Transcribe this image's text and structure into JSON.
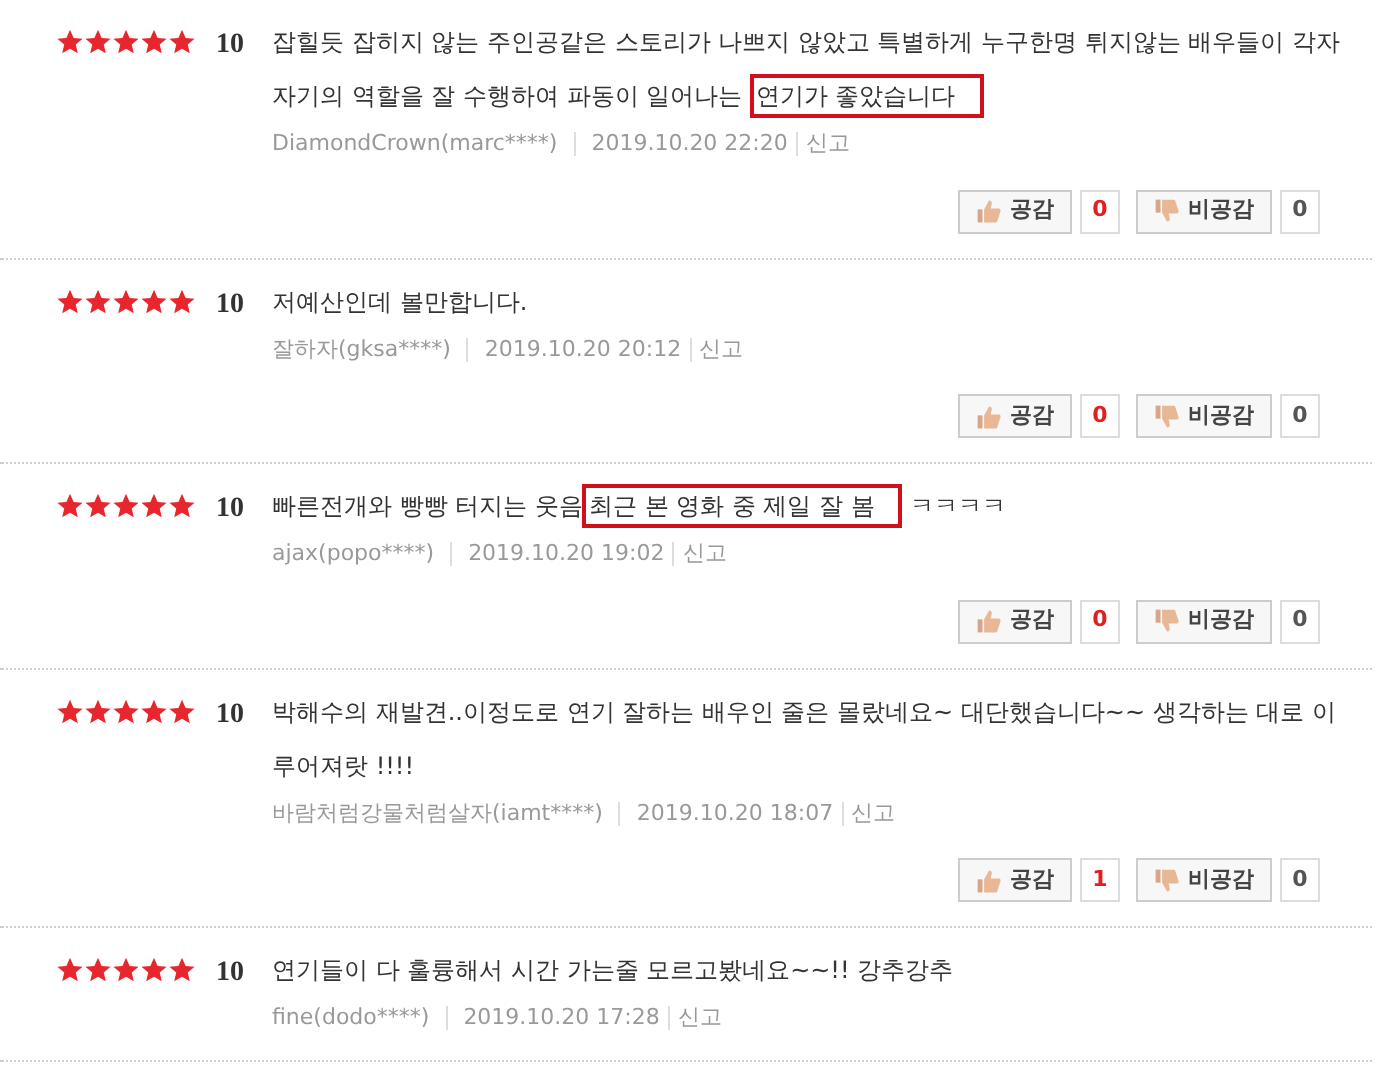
{
  "reviews": [
    {
      "stars": 5,
      "score": "10",
      "segments": [
        {
          "text": "잡힐듯 잡히지 않는 주인공같은 스토리가 나쁘지 않았고 특별하게 누구한명 튀지않는 배우들이 각자 자기의 역할을 잘 수행하여 파동이 일어나는 ",
          "highlighted": false
        },
        {
          "text": "연기가 좋았습니다",
          "highlighted": true
        }
      ],
      "author": "DiamondCrown(marc****)",
      "date": "2019.10.20 22:20",
      "report": "신고",
      "like_label": "공감",
      "like_count": "0",
      "dislike_label": "비공감",
      "dislike_count": "0"
    },
    {
      "stars": 5,
      "score": "10",
      "segments": [
        {
          "text": "저예산인데 볼만합니다.",
          "highlighted": false
        }
      ],
      "author": "잘하자(gksa****)",
      "date": "2019.10.20 20:12",
      "report": "신고",
      "like_label": "공감",
      "like_count": "0",
      "dislike_label": "비공감",
      "dislike_count": "0"
    },
    {
      "stars": 5,
      "score": "10",
      "segments": [
        {
          "text": "빠른전개와 빵빵 터지는 웃음",
          "highlighted": false
        },
        {
          "text": "최근 본 영화 중 제일 잘 봄",
          "highlighted": true
        },
        {
          "text": " ㅋㅋㅋㅋ",
          "highlighted": false
        }
      ],
      "author": "ajax(popo****)",
      "date": "2019.10.20 19:02",
      "report": "신고",
      "like_label": "공감",
      "like_count": "0",
      "dislike_label": "비공감",
      "dislike_count": "0"
    },
    {
      "stars": 5,
      "score": "10",
      "segments": [
        {
          "text": "박해수의 재발견..이정도로 연기 잘하는 배우인 줄은 몰랐네요~ 대단했습니다~~ 생각하는 대로 이루어져랏 !!!!",
          "highlighted": false
        }
      ],
      "author": "바람처럼강물처럼살자(iamt****)",
      "date": "2019.10.20 18:07",
      "report": "신고",
      "like_label": "공감",
      "like_count": "1",
      "dislike_label": "비공감",
      "dislike_count": "0"
    },
    {
      "stars": 5,
      "score": "10",
      "segments": [
        {
          "text": "연기들이 다 훌륭해서 시간 가는줄 모르고봤네요~~!! 강추강추",
          "highlighted": false
        }
      ],
      "author": "fine(dodo****)",
      "date": "2019.10.20 17:28",
      "report": "신고"
    }
  ]
}
